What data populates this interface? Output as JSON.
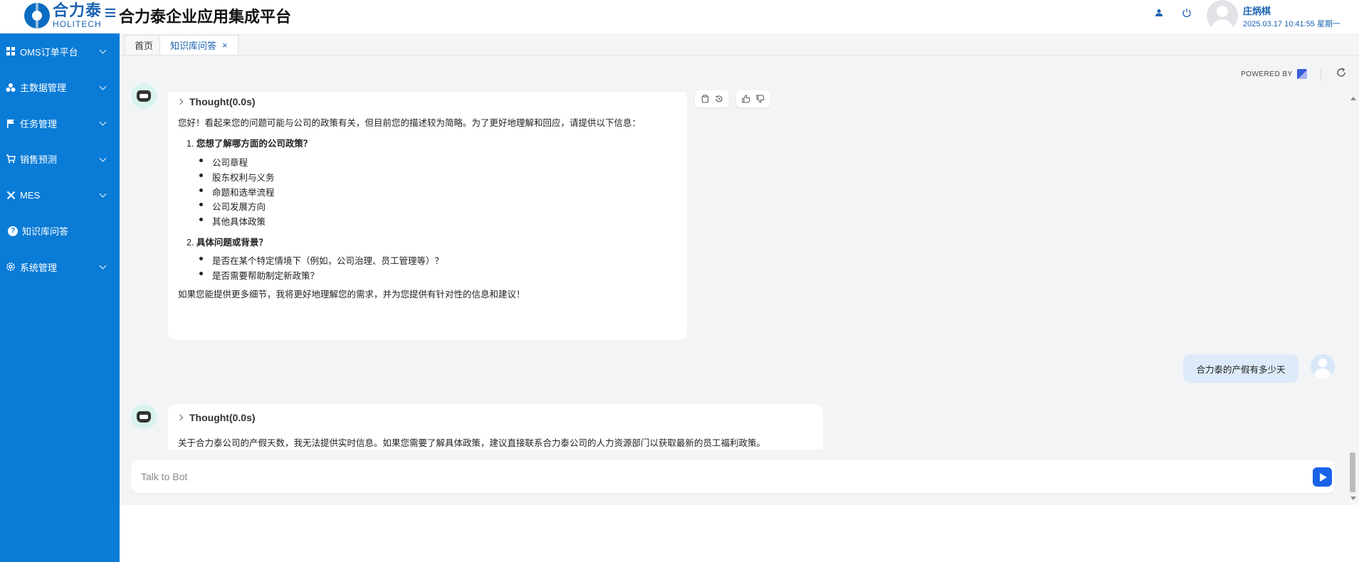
{
  "header": {
    "logo_cn": "合力泰",
    "logo_en": "HOLITECH",
    "app_title": "合力泰企业应用集成平台",
    "user_name": "庄炳棋",
    "user_datetime": "2025.03.17 10:41:55 星期一"
  },
  "sidebar": {
    "items": [
      {
        "label": "OMS订单平台",
        "icon": "grid-icon",
        "expandable": true
      },
      {
        "label": "主数据管理",
        "icon": "cluster-icon",
        "expandable": true
      },
      {
        "label": "任务管理",
        "icon": "flag-icon",
        "expandable": true
      },
      {
        "label": "销售预测",
        "icon": "cart-icon",
        "expandable": true
      },
      {
        "label": "MES",
        "icon": "tools-icon",
        "expandable": true
      },
      {
        "label": "知识库问答",
        "icon": "help-icon",
        "expandable": false
      },
      {
        "label": "系统管理",
        "icon": "gear-icon",
        "expandable": true
      }
    ]
  },
  "tabs": [
    {
      "label": "首页",
      "active": false
    },
    {
      "label": "知识库问答",
      "active": true,
      "close": "×"
    }
  ],
  "chat": {
    "powered_by": "POWERED BY",
    "messages": {
      "bot1": {
        "thought": "Thought(0.0s)",
        "intro": "您好！看起来您的问题可能与公司的政策有关，但目前您的描述较为简略。为了更好地理解和回应，请提供以下信息：",
        "q1_num": "1.",
        "q1": "您想了解哪方面的公司政策？",
        "q1_items": [
          "公司章程",
          "股东权利与义务",
          "命题和选举流程",
          "公司发展方向",
          "其他具体政策"
        ],
        "q2_num": "2.",
        "q2": "具体问题或背景？",
        "q2_items": [
          "是否在某个特定情境下（例如，公司治理、员工管理等）？",
          "是否需要帮助制定新政策？"
        ],
        "outro": "如果您能提供更多细节，我将更好地理解您的需求，并为您提供有针对性的信息和建议！"
      },
      "user1": {
        "text": "合力泰的产假有多少天"
      },
      "bot2": {
        "thought": "Thought(0.0s)",
        "text": "关于合力泰公司的产假天数，我无法提供实时信息。如果您需要了解具体政策，建议直接联系合力泰公司的人力资源部门以获取最新的员工福利政策。"
      }
    },
    "input": {
      "placeholder": "Talk to Bot",
      "value": ""
    }
  },
  "colors": {
    "sidebar_bg": "#0a7bd6",
    "brand_blue": "#1a62b0",
    "send_button": "#1a62e8",
    "chat_bg": "#f3f4f6",
    "user_bubble": "#ddeaf9"
  }
}
